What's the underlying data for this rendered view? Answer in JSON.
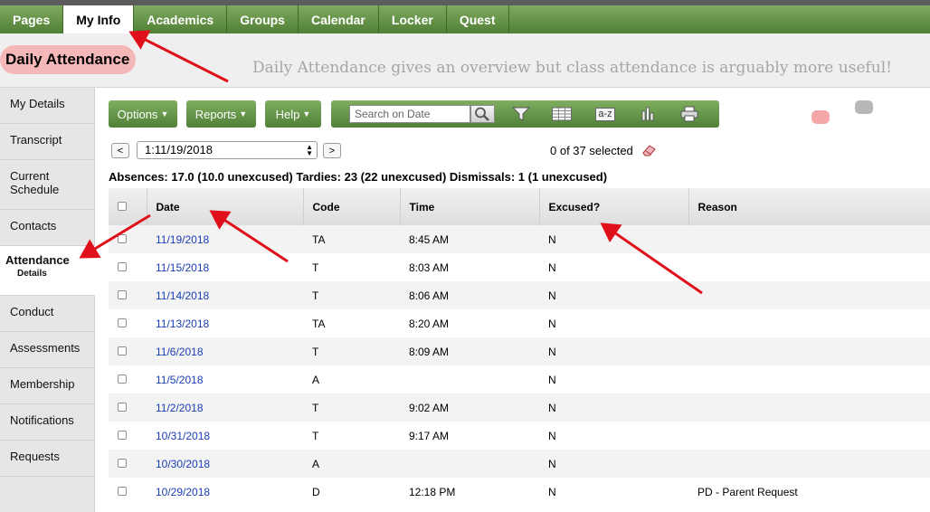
{
  "tabs": [
    {
      "label": "Pages",
      "active": false
    },
    {
      "label": "My Info",
      "active": true
    },
    {
      "label": "Academics",
      "active": false
    },
    {
      "label": "Groups",
      "active": false
    },
    {
      "label": "Calendar",
      "active": false
    },
    {
      "label": "Locker",
      "active": false
    },
    {
      "label": "Quest",
      "active": false
    }
  ],
  "page": {
    "title": "Daily Attendance",
    "note": "Daily Attendance gives an overview but class attendance is arguably more useful!"
  },
  "sidebar": {
    "items": [
      {
        "label": "My Details"
      },
      {
        "label": "Transcript"
      },
      {
        "label": "Current Schedule"
      },
      {
        "label": "Contacts"
      },
      {
        "label": "Attendance",
        "sub": "Details",
        "active": true
      },
      {
        "label": "Conduct"
      },
      {
        "label": "Assessments"
      },
      {
        "label": "Membership"
      },
      {
        "label": "Notifications"
      },
      {
        "label": "Requests"
      }
    ]
  },
  "toolbar": {
    "options_label": "Options",
    "reports_label": "Reports",
    "help_label": "Help",
    "search_placeholder": "Search on Date",
    "icons": [
      "magnifier-icon",
      "filter-icon",
      "grid-icon",
      "sort-az-icon",
      "bar-chart-icon",
      "printer-icon"
    ],
    "sort_text": "a-z"
  },
  "nav": {
    "prev_label": "<",
    "next_label": ">",
    "date_value": "1:11/19/2018",
    "selected_text": "0 of 37 selected"
  },
  "summary": "Absences: 17.0 (10.0 unexcused) Tardies: 23 (22 unexcused) Dismissals: 1 (1 unexcused)",
  "table": {
    "columns": [
      "Date",
      "Code",
      "Time",
      "Excused?",
      "Reason"
    ],
    "rows": [
      {
        "date": "11/19/2018",
        "code": "TA",
        "time": "8:45 AM",
        "excused": "N",
        "reason": ""
      },
      {
        "date": "11/15/2018",
        "code": "T",
        "time": "8:03 AM",
        "excused": "N",
        "reason": ""
      },
      {
        "date": "11/14/2018",
        "code": "T",
        "time": "8:06 AM",
        "excused": "N",
        "reason": ""
      },
      {
        "date": "11/13/2018",
        "code": "TA",
        "time": "8:20 AM",
        "excused": "N",
        "reason": ""
      },
      {
        "date": "11/6/2018",
        "code": "T",
        "time": "8:09 AM",
        "excused": "N",
        "reason": ""
      },
      {
        "date": "11/5/2018",
        "code": "A",
        "time": "",
        "excused": "N",
        "reason": ""
      },
      {
        "date": "11/2/2018",
        "code": "T",
        "time": "9:02 AM",
        "excused": "N",
        "reason": ""
      },
      {
        "date": "10/31/2018",
        "code": "T",
        "time": "9:17 AM",
        "excused": "N",
        "reason": ""
      },
      {
        "date": "10/30/2018",
        "code": "A",
        "time": "",
        "excused": "N",
        "reason": ""
      },
      {
        "date": "10/29/2018",
        "code": "D",
        "time": "12:18 PM",
        "excused": "N",
        "reason": "PD - Parent Request"
      }
    ]
  },
  "colors": {
    "accent_green": "#5a8a3e",
    "link_blue": "#1a3db5",
    "annotation_red": "#e0101a"
  }
}
